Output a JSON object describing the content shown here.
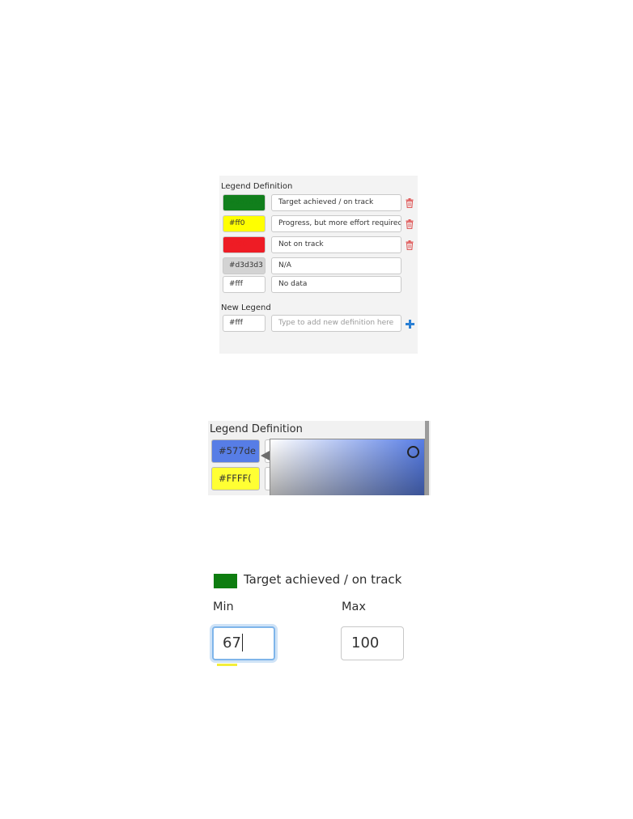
{
  "panel1": {
    "title": "Legend Definition",
    "rows": [
      {
        "hex": "#0a7d1a",
        "color": "#117f1c",
        "text_color": "#117f1c",
        "description": "Target achieved / on track",
        "deletable": true
      },
      {
        "hex": "#ff0",
        "color": "#ffff00",
        "text_color": "#333333",
        "description": "Progress, but more effort required",
        "deletable": true
      },
      {
        "hex": "#f00",
        "color": "#ee1c25",
        "text_color": "#ee1c25",
        "description": "Not on track",
        "deletable": true
      },
      {
        "hex": "#d3d3d3",
        "color": "#d3d3d3",
        "text_color": "#333333",
        "description": "N/A",
        "deletable": false
      },
      {
        "hex": "#fff",
        "color": "#ffffff",
        "text_color": "#333333",
        "description": "No data",
        "deletable": false
      }
    ],
    "new_legend_title": "New Legend",
    "new_legend": {
      "hex": "#fff",
      "placeholder": "Type to add new definition here"
    },
    "delete_icon_color": "#e05a5a",
    "add_icon_color": "#2a7fd4"
  },
  "panel2": {
    "title": "Legend Definition",
    "rows": [
      {
        "hex": "#577de",
        "color": "#577de6"
      },
      {
        "hex": "#FFFF(",
        "color": "#ffff33"
      }
    ],
    "picker_hue": "#577de6"
  },
  "panel3": {
    "legend_color": "#0e7d10",
    "legend_label": "Target achieved / on track",
    "min_label": "Min",
    "max_label": "Max",
    "min_value": "67",
    "max_value": "100"
  }
}
